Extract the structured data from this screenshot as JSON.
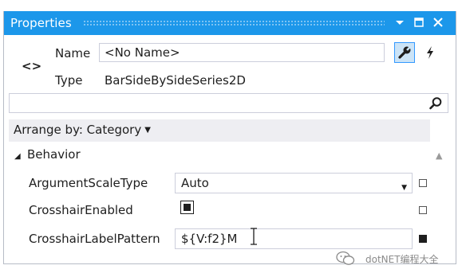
{
  "window": {
    "title": "Properties"
  },
  "header": {
    "name_label": "Name",
    "name_value": "<No Name>",
    "type_label": "Type",
    "type_value": "BarSideBySideSeries2D",
    "object_icon": "code-brackets-icon",
    "properties_view_icon": "wrench-icon",
    "events_view_icon": "lightning-icon"
  },
  "search": {
    "value": "",
    "icon": "search-icon"
  },
  "arrange": {
    "label": "Arrange by: Category"
  },
  "category": {
    "label": "Behavior"
  },
  "properties": [
    {
      "name": "ArgumentScaleType",
      "value": "Auto",
      "editor": "dropdown"
    },
    {
      "name": "CrosshairEnabled",
      "value": "checked",
      "editor": "checkbox"
    },
    {
      "name": "CrosshairLabelPattern",
      "value": "${V:f2}M",
      "editor": "text"
    }
  ],
  "watermark": {
    "text": "dotNET编程大全"
  },
  "colors": {
    "titlebar": "#1c97ea",
    "selected_button_bg": "#cce4f7",
    "selected_button_border": "#3399ff"
  }
}
